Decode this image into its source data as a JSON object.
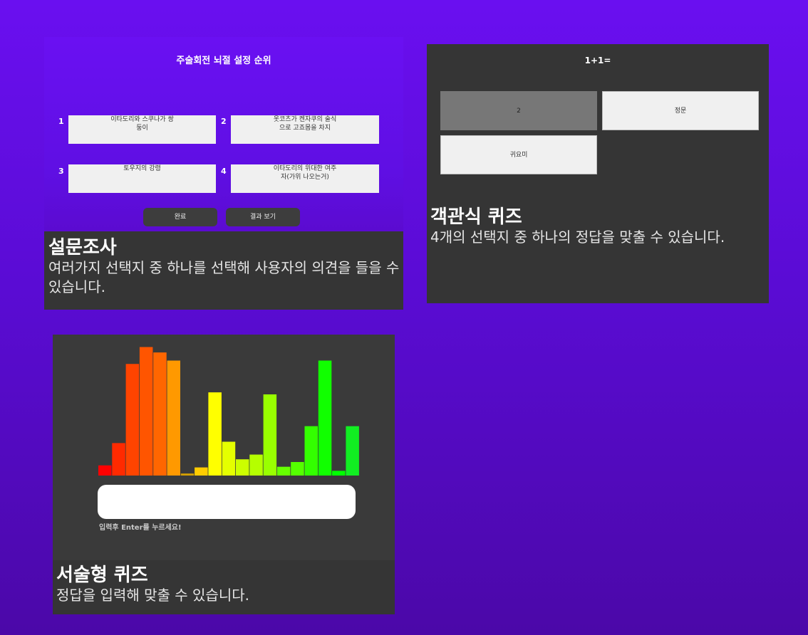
{
  "survey": {
    "title": "주술회전 뇌절 설정 순위",
    "options": [
      {
        "num": "1",
        "text": "이타도리와 스쿠나가 쌍\n둥이"
      },
      {
        "num": "2",
        "text": "옷코츠가 켄자쿠의 술식\n으로 고죠몸을 차지"
      },
      {
        "num": "3",
        "text": "토우지의 강령"
      },
      {
        "num": "4",
        "text": "이타도리의 위대한 여주\n자(가위 나오는거)"
      }
    ],
    "buttons": {
      "done": "완료",
      "results": "결과 보기"
    },
    "caption_title": "설문조사",
    "caption_desc": "여러가지 선택지 중 하나를 선택해 사용자의 의견을 들을 수 있습니다."
  },
  "quiz": {
    "question": "1+1=",
    "options": [
      "2",
      "정문",
      "귀요미"
    ],
    "selected_index": 0,
    "caption_title": "객관식 퀴즈",
    "caption_desc": "4개의 선택지 중 하나의 정답을 맞출 수 있습니다."
  },
  "short_answer": {
    "hint": "입력후 Enter를 누르세요!",
    "caption_title": "서술형 퀴즈",
    "caption_desc": "정답을 입력해 맞출 수 있습니다."
  },
  "chart_data": {
    "type": "bar",
    "values": [
      15,
      48,
      165,
      190,
      182,
      170,
      3,
      12,
      123,
      50,
      24,
      31,
      120,
      13,
      20,
      73,
      170,
      7,
      73
    ],
    "colors": [
      "#ff0000",
      "#ff2a00",
      "#ff4400",
      "#ff5500",
      "#ff6600",
      "#ff9900",
      "#d4a000",
      "#ffcc00",
      "#ffff00",
      "#e5ff00",
      "#ccff00",
      "#b5ff00",
      "#99ff00",
      "#66ff00",
      "#55ff00",
      "#33ff00",
      "#11ff00",
      "#00ff00",
      "#11ee22"
    ],
    "ylim": [
      0,
      200
    ]
  }
}
